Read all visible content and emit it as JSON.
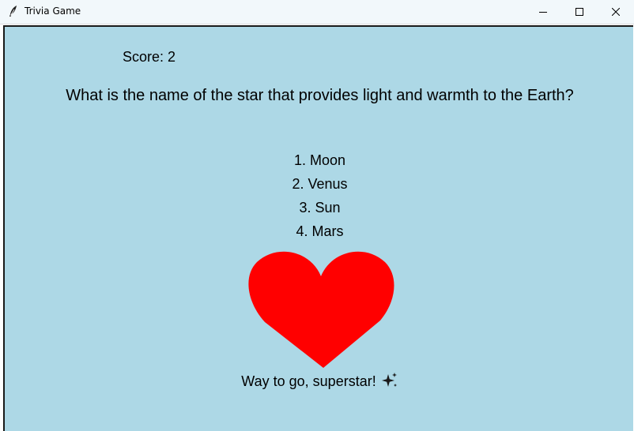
{
  "window": {
    "title": "Trivia Game",
    "icon": "feather-icon"
  },
  "game": {
    "score_label": "Score: 2",
    "question": "What is the name of the star that provides light and warmth to the Earth?",
    "options": [
      "1. Moon",
      "2. Venus",
      "3. Sun",
      "4. Mars"
    ],
    "feedback": "Way to go, superstar!",
    "feedback_icon": "sparkles-icon",
    "result_icon": "heart-icon"
  },
  "colors": {
    "background": "#add8e6",
    "heart": "#ff0000"
  }
}
